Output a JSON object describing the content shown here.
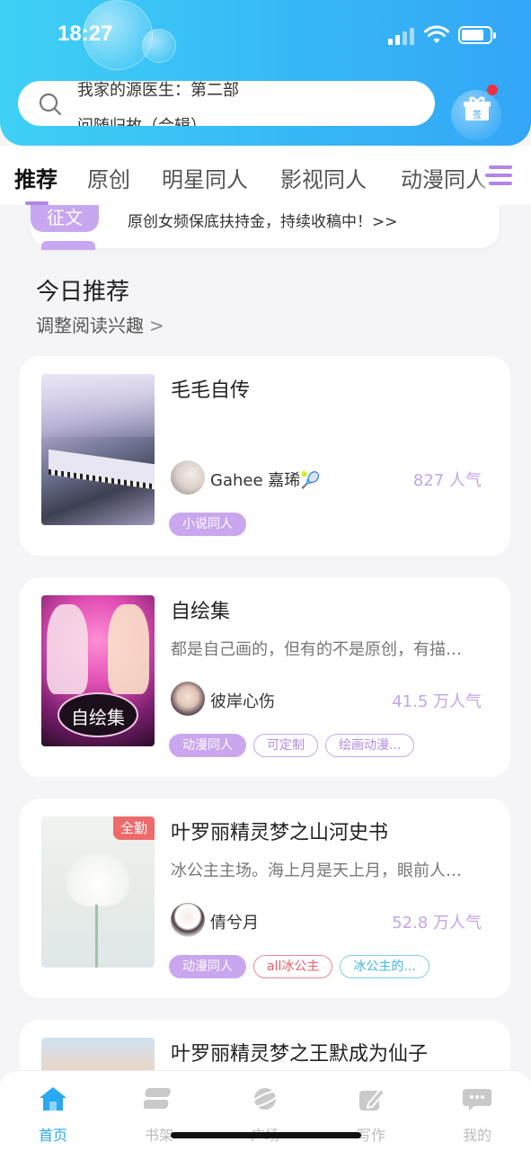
{
  "status_bar": {
    "time": "18:27"
  },
  "search": {
    "line1": "我家的源医生：第二部",
    "line2": "问随归故（合辑）"
  },
  "gift": {
    "label": "签"
  },
  "tabs": [
    {
      "label": "推荐",
      "active": true
    },
    {
      "label": "原创"
    },
    {
      "label": "明星同人"
    },
    {
      "label": "影视同人"
    },
    {
      "label": "动漫同人"
    }
  ],
  "banner": {
    "tag": "征文",
    "text": "原创女频保底扶持金，持续收稿中！>>"
  },
  "section": {
    "title": "今日推荐",
    "subtitle": "调整阅读兴趣"
  },
  "cards": [
    {
      "title": "毛毛自传",
      "desc": "",
      "author": "Gahee 嘉琋🎾",
      "popularity": "827 人气",
      "tags": [
        {
          "label": "小说同人",
          "style": "fill"
        }
      ]
    },
    {
      "title": "自绘集",
      "desc": "都是自己画的，但有的不是原创，有描…",
      "author": "彼岸心伤",
      "popularity": "41.5 万人气",
      "cover_text": "自绘集",
      "tags": [
        {
          "label": "动漫同人",
          "style": "fill"
        },
        {
          "label": "可定制",
          "style": "purple"
        },
        {
          "label": "绘画动漫...",
          "style": "purple"
        }
      ]
    },
    {
      "title": "叶罗丽精灵梦之山河史书",
      "desc": "冰公主主场。海上月是天上月，眼前人…",
      "author": "倩兮月",
      "popularity": "52.8 万人气",
      "badge": "全勤",
      "tags": [
        {
          "label": "动漫同人",
          "style": "fill"
        },
        {
          "label": "all冰公主",
          "style": "red"
        },
        {
          "label": "冰公主的...",
          "style": "cyan"
        }
      ]
    },
    {
      "title": "叶罗丽精灵梦之王默成为仙子"
    }
  ],
  "tabbar": [
    {
      "label": "首页",
      "icon": "home-icon",
      "active": true
    },
    {
      "label": "书架",
      "icon": "bookshelf-icon"
    },
    {
      "label": "广场",
      "icon": "planet-icon"
    },
    {
      "label": "写作",
      "icon": "pen-icon"
    },
    {
      "label": "我的",
      "icon": "chat-bubble-icon"
    }
  ],
  "colors": {
    "header_start": "#3fd0f5",
    "header_end": "#33a6f7",
    "accent_purple": "#c8a7f1",
    "active_blue": "#29a9f0",
    "notify_red": "#f03044"
  }
}
